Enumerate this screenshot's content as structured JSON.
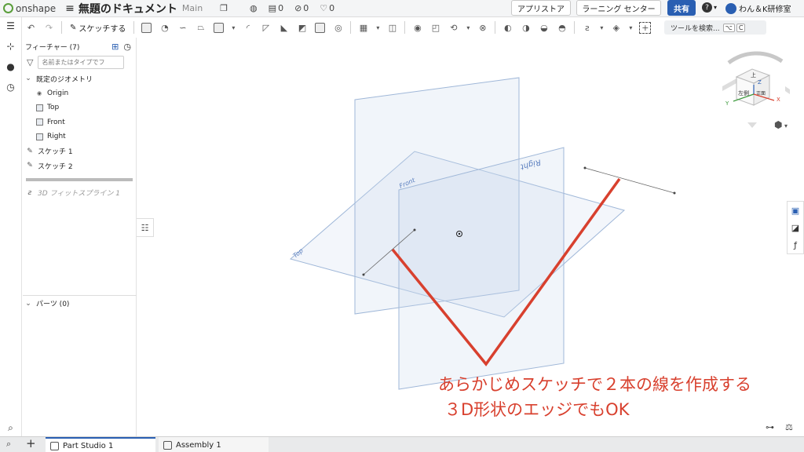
{
  "app": {
    "logo_text": "onshape",
    "doc_title": "無題のドキュメント",
    "workspace": "Main",
    "counts": {
      "versions": "0",
      "links": "0",
      "likes": "0"
    }
  },
  "header": {
    "app_store": "アプリストア",
    "learning": "ラーニング センター",
    "share": "共有",
    "help_icon": "?",
    "user_name": "わん＆K研修室"
  },
  "toolbar": {
    "sketch_label": "スケッチする",
    "tool_search": "ツールを検索...",
    "tool_search_kbd1": "⌥",
    "tool_search_kbd2": "C"
  },
  "feature_panel": {
    "header": "フィーチャー (7)",
    "filter_placeholder": "名前またはタイプでフ",
    "default_geometry": "既定のジオメトリ",
    "geometry_items": [
      "Origin",
      "Top",
      "Front",
      "Right"
    ],
    "sketches": [
      "スケッチ 1",
      "スケッチ 2"
    ],
    "spline": "3D フィットスプライン 1",
    "parts": "パーツ (0)"
  },
  "viewport": {
    "plane_labels": {
      "top": "Top",
      "front": "Front",
      "right": "Right"
    },
    "view_cube": {
      "top": "上",
      "left": "左側",
      "front": "正面",
      "x": "X",
      "y": "Y",
      "z": "Z"
    }
  },
  "annotation": {
    "line1": "あらかじめスケッチで２本の線を作成する",
    "line2": "３D形状のエッジでもOK"
  },
  "tabs": [
    "Part Studio 1",
    "Assembly 1"
  ],
  "colors": {
    "accent": "#2a5fb2",
    "highlight": "#d8402e",
    "plane_edge": "#9fb7d8"
  }
}
